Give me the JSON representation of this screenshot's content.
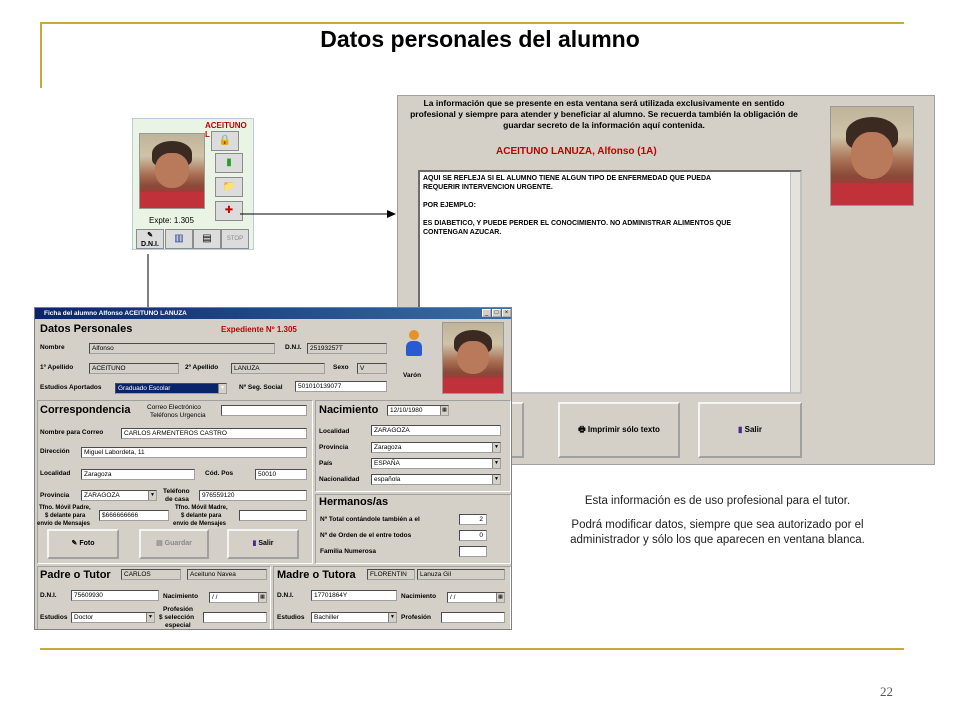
{
  "slide": {
    "title": "Datos personales del alumno",
    "page_number": "22",
    "caption1": "Esta información es de uso profesional para el tutor.",
    "caption2": "Podrá modificar datos, siempre que sea autorizado por el administrador y sólo los que aparecen en ventana blanca."
  },
  "mini": {
    "name": "ACEITUNO L",
    "expte": "Expte: 1.305",
    "dni_label": "D.N.I.",
    "stop_label": "STOP"
  },
  "notes": {
    "warning": "La información que se presente en esta ventana será utilizada exclusivamente en sentido profesional y siempre para atender y beneficiar al alumno. Se recuerda también la obligación de guardar secreto de la información aquí contenida.",
    "student_name": "ACEITUNO LANUZA, Alfonso  (1A)",
    "text_line1": "AQUI SE REFLEJA SI EL ALUMNO TIENE ALGUN TIPO DE ENFERMEDAD QUE PUEDA",
    "text_line2": "REQUERIR INTERVENCION URGENTE.",
    "text_line3": "POR EJEMPLO:",
    "text_line4": "ES DIABETICO, Y PUEDE PERDER EL CONOCIMIENTO. NO ADMINISTRAR ALIMENTOS QUE",
    "text_line5": "CONTENGAN AZUCAR.",
    "print_button": "Imprimir sólo texto",
    "exit_button": "Salir"
  },
  "form": {
    "window_title": "Ficha del alumno Alfonso ACEITUNO LANUZA",
    "heading": "Datos Personales",
    "expediente": "Expediente Nº 1.305",
    "nombre_label": "Nombre",
    "nombre": "Alfonso",
    "dni_label": "D.N.I.",
    "dni": "25193257T",
    "ap1_label": "1º Apellido",
    "ap1": "ACEITUNO",
    "ap2_label": "2º Apellido",
    "ap2": "LANUZA",
    "sexo_label": "Sexo",
    "sexo": "V",
    "estudios_label": "Estudios Aportados",
    "estudios": "Graduado Escolar",
    "nss_label": "Nº Seg. Social",
    "nss": "501010139077",
    "gender": "Varón",
    "corr_heading": "Correspondencia",
    "email_label": "Correo Electrónico",
    "urg_label": "Teléfonos Urgencia",
    "ncorreo_label": "Nombre para Correo",
    "ncorreo": "CARLOS ARMENTEROS CASTRO",
    "dir_label": "Dirección",
    "dir": "Miguel Labordeta, 11",
    "loc_label": "Localidad",
    "loc": "Zaragoza",
    "cp_label": "Cód. Pos",
    "cp": "50010",
    "prov_label": "Provincia",
    "prov": "ZARAGOZA",
    "tel_label1": "Teléfono",
    "tel_label2": "de casa",
    "tel": "976559120",
    "movp_label1": "Tfno. Móvil Padre,",
    "movp_label2": "$ delante para",
    "movp_label3": "envío de Mensajes",
    "movp": "$666666666",
    "movm_label1": "Tfno. Móvil Madre,",
    "movm_label2": "$ delante para",
    "movm_label3": "envío de Mensajes",
    "btn_foto": "Foto",
    "btn_guardar": "Guardar",
    "btn_salir": "Salir",
    "nac_heading": "Nacimiento",
    "nac_fecha": "12/10/1980",
    "nloc_label": "Localidad",
    "nloc": "ZARAGOZA",
    "nprov_label": "Provincia",
    "nprov": "Zaragoza",
    "pais_label": "País",
    "pais": "ESPAÑA",
    "nacion_label": "Nacionalidad",
    "nacion": "española",
    "herm_heading": "Hermanos/as",
    "herm1_label": "Nº Total contándole también a el",
    "herm1": "2",
    "herm2_label": "Nº de Orden de el entre todos",
    "herm2": "0",
    "herm3_label": "Familia Numerosa",
    "padre_heading": "Padre o Tutor",
    "padre_nombre": "CARLOS",
    "padre_apellidos": "Aceituno Navea",
    "padre_dni_label": "D.N.I.",
    "padre_dni": "75609930",
    "padre_nac_label": "Nacimiento",
    "padre_nac": " /  /",
    "padre_est_label": "Estudios",
    "padre_est": "Doctor",
    "padre_prof_label1": "Profesión",
    "padre_prof_label2": "$ selección",
    "padre_prof_label3": "especial",
    "madre_heading": "Madre o Tutora",
    "madre_nombre": "FLORENTIN",
    "madre_apellidos": "Lanuza Gil",
    "madre_dni_label": "D.N.I.",
    "madre_dni": "17701864Y",
    "madre_nac_label": "Nacimiento",
    "madre_nac": " /  /",
    "madre_est_label": "Estudios",
    "madre_est": "Bachiller",
    "madre_prof_label": "Profesión"
  },
  "colors": {
    "accent_gold": "#c8aa3c",
    "title_bar": "#0a246a",
    "expediente_red": "#c00000"
  },
  "icons": [
    "lock-icon",
    "phone-icon",
    "folder-icon",
    "bike-icon",
    "id-card-icon",
    "book-icon",
    "printer-icon",
    "door-icon",
    "person-icon",
    "calendar-icon"
  ]
}
